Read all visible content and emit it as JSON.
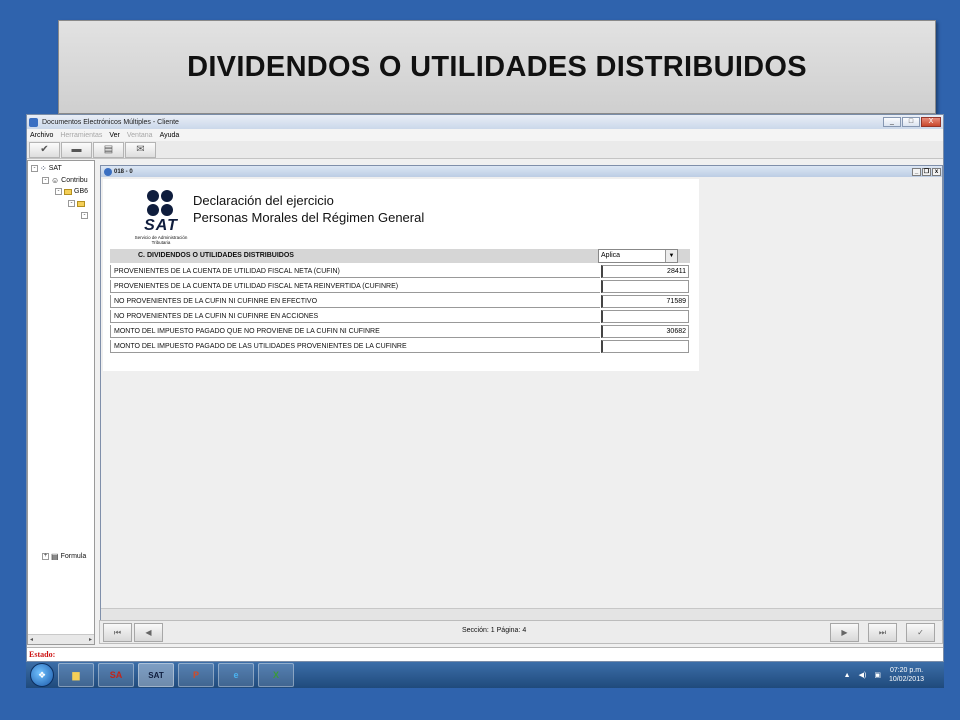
{
  "slide_title": "DIVIDENDOS O UTILIDADES DISTRIBUIDOS",
  "app": {
    "title": "Documentos Electrónicos Múltiples - Cliente",
    "menu": [
      {
        "label": "Archivo",
        "enabled": true
      },
      {
        "label": "Herramientas",
        "enabled": false
      },
      {
        "label": "Ver",
        "enabled": true
      },
      {
        "label": "Ventana",
        "enabled": false
      },
      {
        "label": "Ayuda",
        "enabled": true
      }
    ],
    "window_buttons": {
      "minimize": "_",
      "maximize": "□",
      "close": "X"
    }
  },
  "tree": {
    "items": [
      {
        "label": "SAT",
        "expander": "-"
      },
      {
        "label": "Contribu",
        "expander": "-"
      },
      {
        "label": "GB6",
        "expander": "-"
      },
      {
        "label": "",
        "expander": "-"
      },
      {
        "label": "",
        "expander": "-"
      },
      {
        "label": "Formula",
        "expander": "+"
      }
    ]
  },
  "child_window": {
    "title": "018 - 0",
    "buttons": {
      "minimize": "_",
      "restore": "❐",
      "close": "x"
    }
  },
  "form": {
    "logo_text": "SAT",
    "logo_subtext": "Servicio de Administración Tributaria",
    "heading_line1": "Declaración del ejercicio",
    "heading_line2": "Personas Morales del Régimen General",
    "section_title": "C. DIVIDENDOS O UTILIDADES DISTRIBUIDOS",
    "aplica_value": "Aplica",
    "rows": [
      {
        "label": "PROVENIENTES DE LA CUENTA DE UTILIDAD FISCAL NETA (CUFIN)",
        "value": "28411"
      },
      {
        "label": "PROVENIENTES DE LA CUENTA DE UTILIDAD FISCAL NETA REINVERTIDA (CUFINRE)",
        "value": ""
      },
      {
        "label": "NO PROVENIENTES DE LA CUFIN NI CUFINRE EN EFECTIVO",
        "value": "71589"
      },
      {
        "label": "NO PROVENIENTES DE LA CUFIN NI CUFINRE EN ACCIONES",
        "value": ""
      },
      {
        "label": "MONTO DEL IMPUESTO PAGADO QUE NO PROVIENE DE LA CUFIN NI CUFINRE",
        "value": "30682"
      },
      {
        "label": "MONTO DEL IMPUESTO PAGADO DE LAS UTILIDADES PROVENIENTES DE LA CUFINRE",
        "value": ""
      }
    ]
  },
  "navigation": {
    "section_page": "Sección: 1  Página: 4"
  },
  "status_label": "Estado:",
  "taskbar": {
    "sa_label": "SA",
    "sat_label": "SAT",
    "clock_time": "07:20 p.m.",
    "clock_date": "10/02/2013"
  }
}
